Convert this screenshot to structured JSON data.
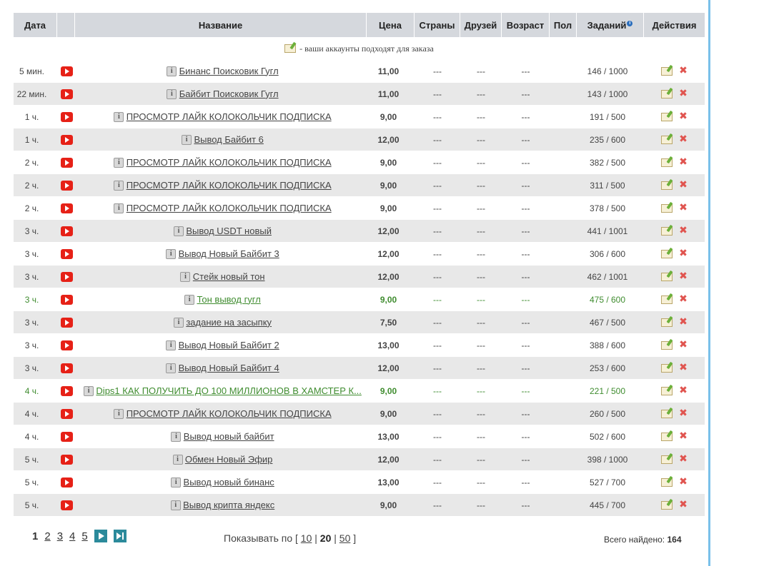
{
  "header": {
    "date": "Дата",
    "name": "Название",
    "price": "Цена",
    "countries": "Страны",
    "friends": "Друзей",
    "age": "Возраст",
    "gender": "Пол",
    "tasks": "Заданий",
    "actions": "Действия"
  },
  "note": "- ваши аккаунты подходят для заказа",
  "rows": [
    {
      "time": "5 мин.",
      "name": "Бинанс Поисковик Гугл",
      "price": "11,00",
      "countries": "---",
      "friends": "---",
      "age": "---",
      "tasks": "146 / 1000"
    },
    {
      "time": "22 мин.",
      "name": "Байбит Поисковик Гугл",
      "price": "11,00",
      "countries": "---",
      "friends": "---",
      "age": "---",
      "tasks": "143 / 1000"
    },
    {
      "time": "1 ч.",
      "name": "ПРОСМОТР ЛАЙК КОЛОКОЛЬЧИК ПОДПИСКА",
      "price": "9,00",
      "countries": "---",
      "friends": "---",
      "age": "---",
      "tasks": "191 / 500"
    },
    {
      "time": "1 ч.",
      "name": "Вывод Байбит 6",
      "price": "12,00",
      "countries": "---",
      "friends": "---",
      "age": "---",
      "tasks": "235 / 600"
    },
    {
      "time": "2 ч.",
      "name": "ПРОСМОТР ЛАЙК КОЛОКОЛЬЧИК ПОДПИСКА",
      "price": "9,00",
      "countries": "---",
      "friends": "---",
      "age": "---",
      "tasks": "382 / 500"
    },
    {
      "time": "2 ч.",
      "name": "ПРОСМОТР ЛАЙК КОЛОКОЛЬЧИК ПОДПИСКА",
      "price": "9,00",
      "countries": "---",
      "friends": "---",
      "age": "---",
      "tasks": "311 / 500"
    },
    {
      "time": "2 ч.",
      "name": "ПРОСМОТР ЛАЙК КОЛОКОЛЬЧИК ПОДПИСКА",
      "price": "9,00",
      "countries": "---",
      "friends": "---",
      "age": "---",
      "tasks": "378 / 500"
    },
    {
      "time": "3 ч.",
      "name": "Вывод USDT новый",
      "price": "12,00",
      "countries": "---",
      "friends": "---",
      "age": "---",
      "tasks": "441 / 1001"
    },
    {
      "time": "3 ч.",
      "name": "Вывод Новый Байбит 3",
      "price": "12,00",
      "countries": "---",
      "friends": "---",
      "age": "---",
      "tasks": "306 / 600"
    },
    {
      "time": "3 ч.",
      "name": "Стейк новый тон",
      "price": "12,00",
      "countries": "---",
      "friends": "---",
      "age": "---",
      "tasks": "462 / 1001"
    },
    {
      "time": "3 ч.",
      "name": "Тон вывод гугл",
      "price": "9,00",
      "countries": "---",
      "friends": "---",
      "age": "---",
      "tasks": "475 / 600",
      "highlight": true
    },
    {
      "time": "3 ч.",
      "name": "задание на засыпку",
      "price": "7,50",
      "countries": "---",
      "friends": "---",
      "age": "---",
      "tasks": "467 / 500"
    },
    {
      "time": "3 ч.",
      "name": "Вывод Новый Байбит 2",
      "price": "13,00",
      "countries": "---",
      "friends": "---",
      "age": "---",
      "tasks": "388 / 600"
    },
    {
      "time": "3 ч.",
      "name": "Вывод Новый Байбит 4",
      "price": "12,00",
      "countries": "---",
      "friends": "---",
      "age": "---",
      "tasks": "253 / 600"
    },
    {
      "time": "4 ч.",
      "name": "Dips1 КАК ПОЛУЧИТЬ ДО 100 МИЛЛИОНОВ В ХАМСТЕР К...",
      "price": "9,00",
      "countries": "---",
      "friends": "---",
      "age": "---",
      "tasks": "221 / 500",
      "highlight": true
    },
    {
      "time": "4 ч.",
      "name": "ПРОСМОТР ЛАЙК КОЛОКОЛЬЧИК ПОДПИСКА",
      "price": "9,00",
      "countries": "---",
      "friends": "---",
      "age": "---",
      "tasks": "260 / 500"
    },
    {
      "time": "4 ч.",
      "name": "Вывод новый байбит",
      "price": "13,00",
      "countries": "---",
      "friends": "---",
      "age": "---",
      "tasks": "502 / 600"
    },
    {
      "time": "5 ч.",
      "name": "Обмен Новый Эфир",
      "price": "12,00",
      "countries": "---",
      "friends": "---",
      "age": "---",
      "tasks": "398 / 1000"
    },
    {
      "time": "5 ч.",
      "name": "Вывод новый бинанс",
      "price": "13,00",
      "countries": "---",
      "friends": "---",
      "age": "---",
      "tasks": "527 / 700"
    },
    {
      "time": "5 ч.",
      "name": "Вывод крипта яндекс",
      "price": "9,00",
      "countries": "---",
      "friends": "---",
      "age": "---",
      "tasks": "445 / 700"
    }
  ],
  "pagination": {
    "current": "1",
    "pages": [
      "2",
      "3",
      "4",
      "5"
    ]
  },
  "per_page": {
    "label": "Показывать по",
    "open": "[",
    "close": "]",
    "sep": "|",
    "options": [
      "10",
      "20",
      "50"
    ],
    "selected": "20"
  },
  "total": {
    "label": "Всего найдено:",
    "value": "164"
  },
  "colors": {
    "header_bg": "#d5d8dd",
    "row_alt_bg": "#e8e8e8",
    "highlight_text": "#3f8c2f",
    "youtube_red": "#e62117",
    "delete_red": "#e0544f",
    "nav_teal": "#2b8a9b",
    "frame_blue": "#79c0ea"
  },
  "icons": {
    "service": "youtube-icon",
    "info": "info-icon",
    "edit": "edit-icon",
    "delete": "delete-icon",
    "next": "next-page-icon",
    "last": "last-page-icon"
  }
}
